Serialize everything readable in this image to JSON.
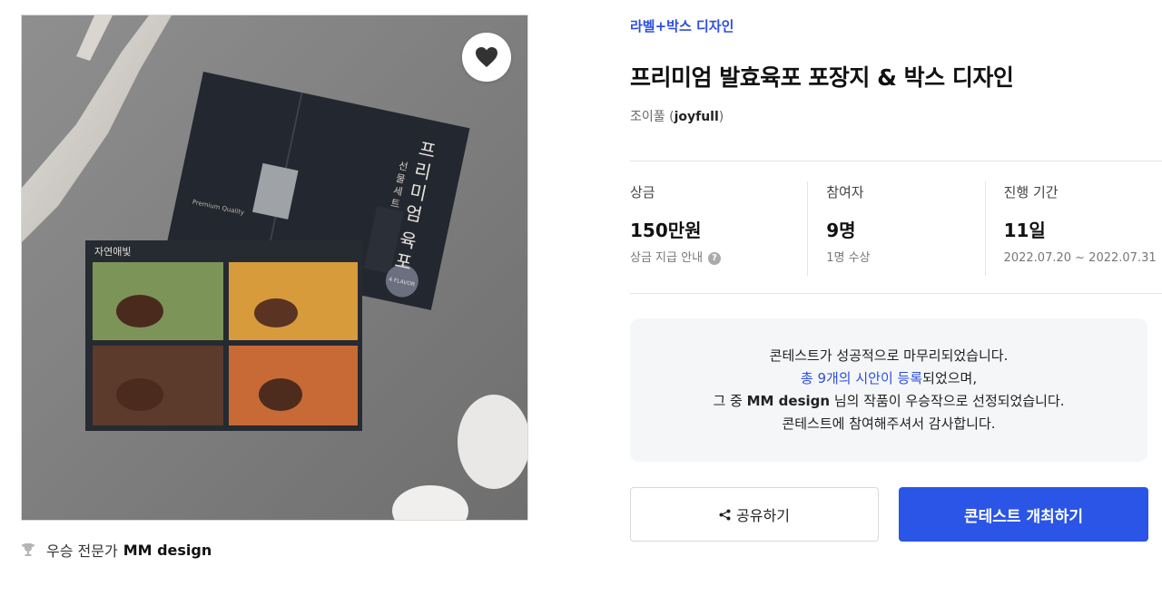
{
  "media": {
    "image_label": "product-photo",
    "like_icon": "heart-icon",
    "box_texts": {
      "lid_title": "프리미엄 육포",
      "lid_subtitle": "선물세트",
      "lid_tagline": "Premium Quality",
      "lid_badge": "4 FLAVOR",
      "tray_brand": "자연애빛"
    }
  },
  "winner": {
    "icon": "trophy-icon",
    "prefix": "우승 전문가",
    "name": "MM design"
  },
  "contest": {
    "category": "라벨+박스 디자인",
    "title": "프리미엄 발효육포 포장지 & 박스 디자인",
    "host_name": "조이풀",
    "host_open": "(",
    "host_handle": "joyfull",
    "host_close": ")"
  },
  "stats": {
    "prize": {
      "label": "상금",
      "value": "150만원",
      "sub": "상금 지급 안내",
      "icon": "help-icon",
      "icon_glyph": "?"
    },
    "participants": {
      "label": "참여자",
      "value": "9명",
      "sub": "1명 수상"
    },
    "period": {
      "label": "진행 기간",
      "value": "11일",
      "sub": "2022.07.20 ~ 2022.07.31"
    }
  },
  "notice": {
    "line1": "콘테스트가 성공적으로 마무리되었습니다.",
    "line2_link": "총 9개의 시안이 등록",
    "line2_rest": "되었으며,",
    "line3_pre": "그 중 ",
    "line3_name": "MM design",
    "line3_post": " 님의 작품이 우승작으로 선정되었습니다.",
    "line4": "콘테스트에 참여해주셔서 감사합니다."
  },
  "buttons": {
    "share": "공유하기",
    "share_icon": "share-icon",
    "host": "콘테스트 개최하기"
  },
  "colors": {
    "accent": "#2b55e6",
    "link": "#2d4fe0",
    "notice_bg": "#f5f6f8"
  }
}
